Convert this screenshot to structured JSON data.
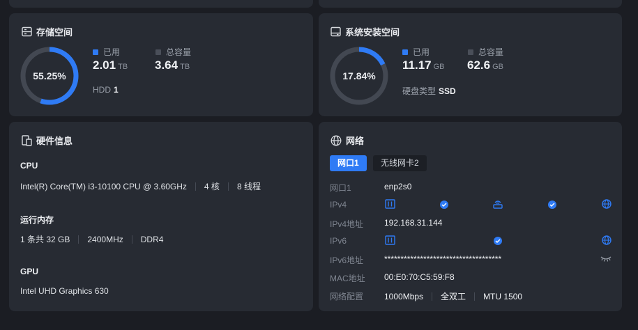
{
  "storage": {
    "title": "存储空间",
    "percent_label": "55.25%",
    "percent": 55.25,
    "used_label": "已用",
    "used_value": "2.01",
    "used_unit": "TB",
    "total_label": "总容量",
    "total_value": "3.64",
    "total_unit": "TB",
    "disk_type": "HDD",
    "disk_count": "1"
  },
  "system": {
    "title": "系统安装空间",
    "percent_label": "17.84%",
    "percent": 17.84,
    "used_label": "已用",
    "used_value": "11.17",
    "used_unit": "GB",
    "total_label": "总容量",
    "total_value": "62.6",
    "total_unit": "GB",
    "disk_type_label": "硬盘类型",
    "disk_type": "SSD"
  },
  "hardware": {
    "title": "硬件信息",
    "cpu_label": "CPU",
    "cpu_model": "Intel(R) Core(TM) i3-10100 CPU @ 3.60GHz",
    "cpu_cores": "4 核",
    "cpu_threads": "8 线程",
    "mem_label": "运行内存",
    "mem_size": "1 条共 32 GB",
    "mem_freq": "2400MHz",
    "mem_type": "DDR4",
    "gpu_label": "GPU",
    "gpu_model": "Intel UHD Graphics 630"
  },
  "network": {
    "title": "网络",
    "tabs": [
      "网口1",
      "无线网卡2"
    ],
    "rows": {
      "port_label": "网口1",
      "port_value": "enp2s0",
      "ipv4_label": "IPv4",
      "ipv4_addr_label": "IPv4地址",
      "ipv4_addr": "192.168.31.144",
      "ipv6_label": "IPv6",
      "ipv6_addr_label": "IPv6地址",
      "ipv6_addr": "************************************",
      "mac_label": "MAC地址",
      "mac": "00:E0:70:C5:59:F8",
      "config_label": "网络配置",
      "speed": "1000Mbps",
      "duplex": "全双工",
      "mtu": "MTU 1500"
    }
  },
  "colors": {
    "accent": "#2f7bf5",
    "card": "#272b33",
    "background": "#1b1d23",
    "ring_track": "#434852"
  }
}
